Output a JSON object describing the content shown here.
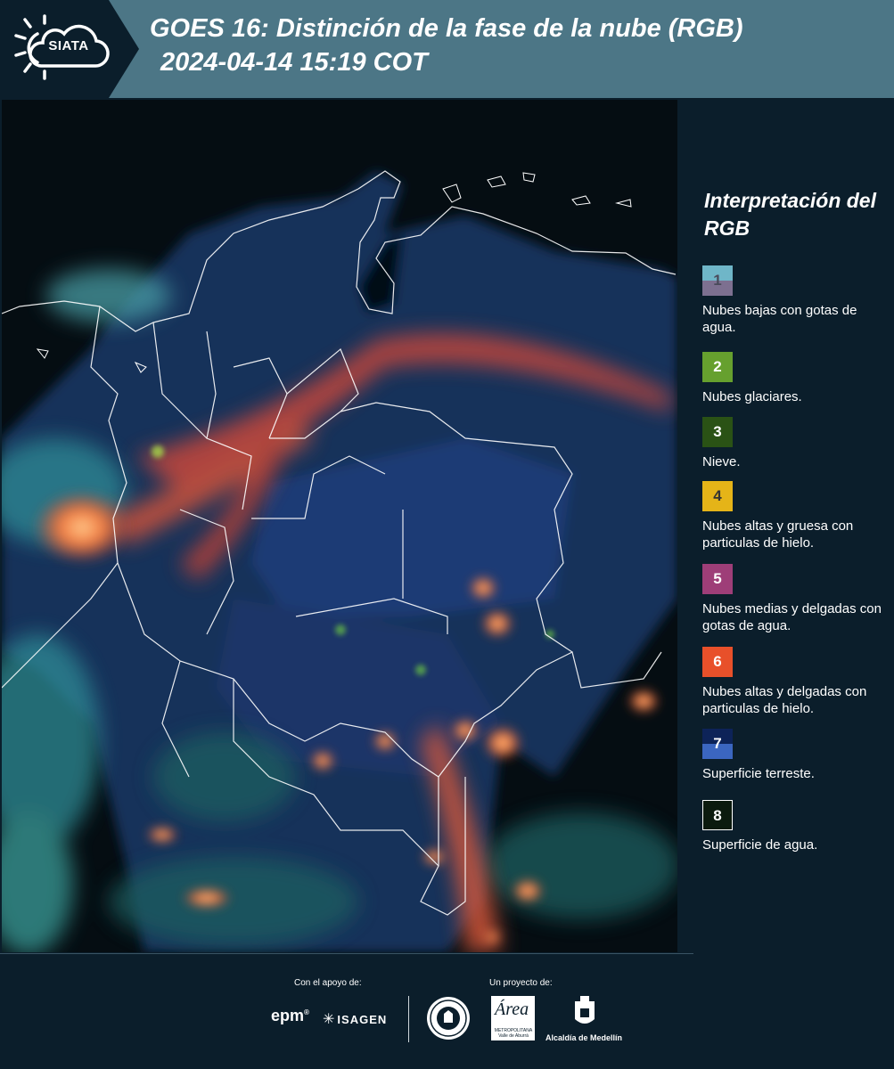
{
  "header": {
    "logo_text": "SIATA",
    "title": "GOES 16: Distinción de la fase de la nube (RGB)",
    "subtitle": "2024-04-14 15:19 COT"
  },
  "legend": {
    "title": "Interpretación del RGB",
    "items": [
      {
        "number": "1",
        "desc": "Nubes bajas con gotas de agua.",
        "color_top": "#6fb6c8",
        "color_bottom": "#7d7090",
        "text_color": "#4a4a5a"
      },
      {
        "number": "2",
        "desc": "Nubes glaciares.",
        "color_top": "#66a02e",
        "color_bottom": "#66a02e",
        "text_color": "#ffffff"
      },
      {
        "number": "3",
        "desc": "Nieve.",
        "color_top": "#2a5215",
        "color_bottom": "#2a5215",
        "text_color": "#ffffff"
      },
      {
        "number": "4",
        "desc": "Nubes altas y gruesa con particulas de hielo.",
        "color_top": "#e5b418",
        "color_bottom": "#e5b418",
        "text_color": "#333333"
      },
      {
        "number": "5",
        "desc": "Nubes medias y delgadas con gotas de agua.",
        "color_top": "#9e3e78",
        "color_bottom": "#9e3e78",
        "text_color": "#ffffff"
      },
      {
        "number": "6",
        "desc": "Nubes altas y delgadas con particulas de hielo.",
        "color_top": "#e8502a",
        "color_bottom": "#e8502a",
        "text_color": "#ffffff"
      },
      {
        "number": "7",
        "desc": "Superficie terreste.",
        "color_top": "#0d2358",
        "color_bottom": "#3b66c0",
        "text_color": "#ffffff"
      },
      {
        "number": "8",
        "desc": "Superficie de agua.",
        "color_top": "#0b1a0e",
        "color_bottom": "#0b1a0e",
        "text_color": "#ffffff"
      }
    ]
  },
  "footer": {
    "support_label": "Con el apoyo de:",
    "project_label": "Un proyecto de:",
    "epm": "epm",
    "isagen": "ISAGEN",
    "area_word": "Área",
    "area_sub": "METROPOLITANA Valle de Aburrá",
    "alcaldia": "Alcaldía de Medellín"
  },
  "map": {
    "type": "satellite RGB cloud phase image",
    "icons": [
      "sun-cloud-icon",
      "seal-icon",
      "coat-of-arms-icon",
      "isagen-star-icon"
    ]
  }
}
